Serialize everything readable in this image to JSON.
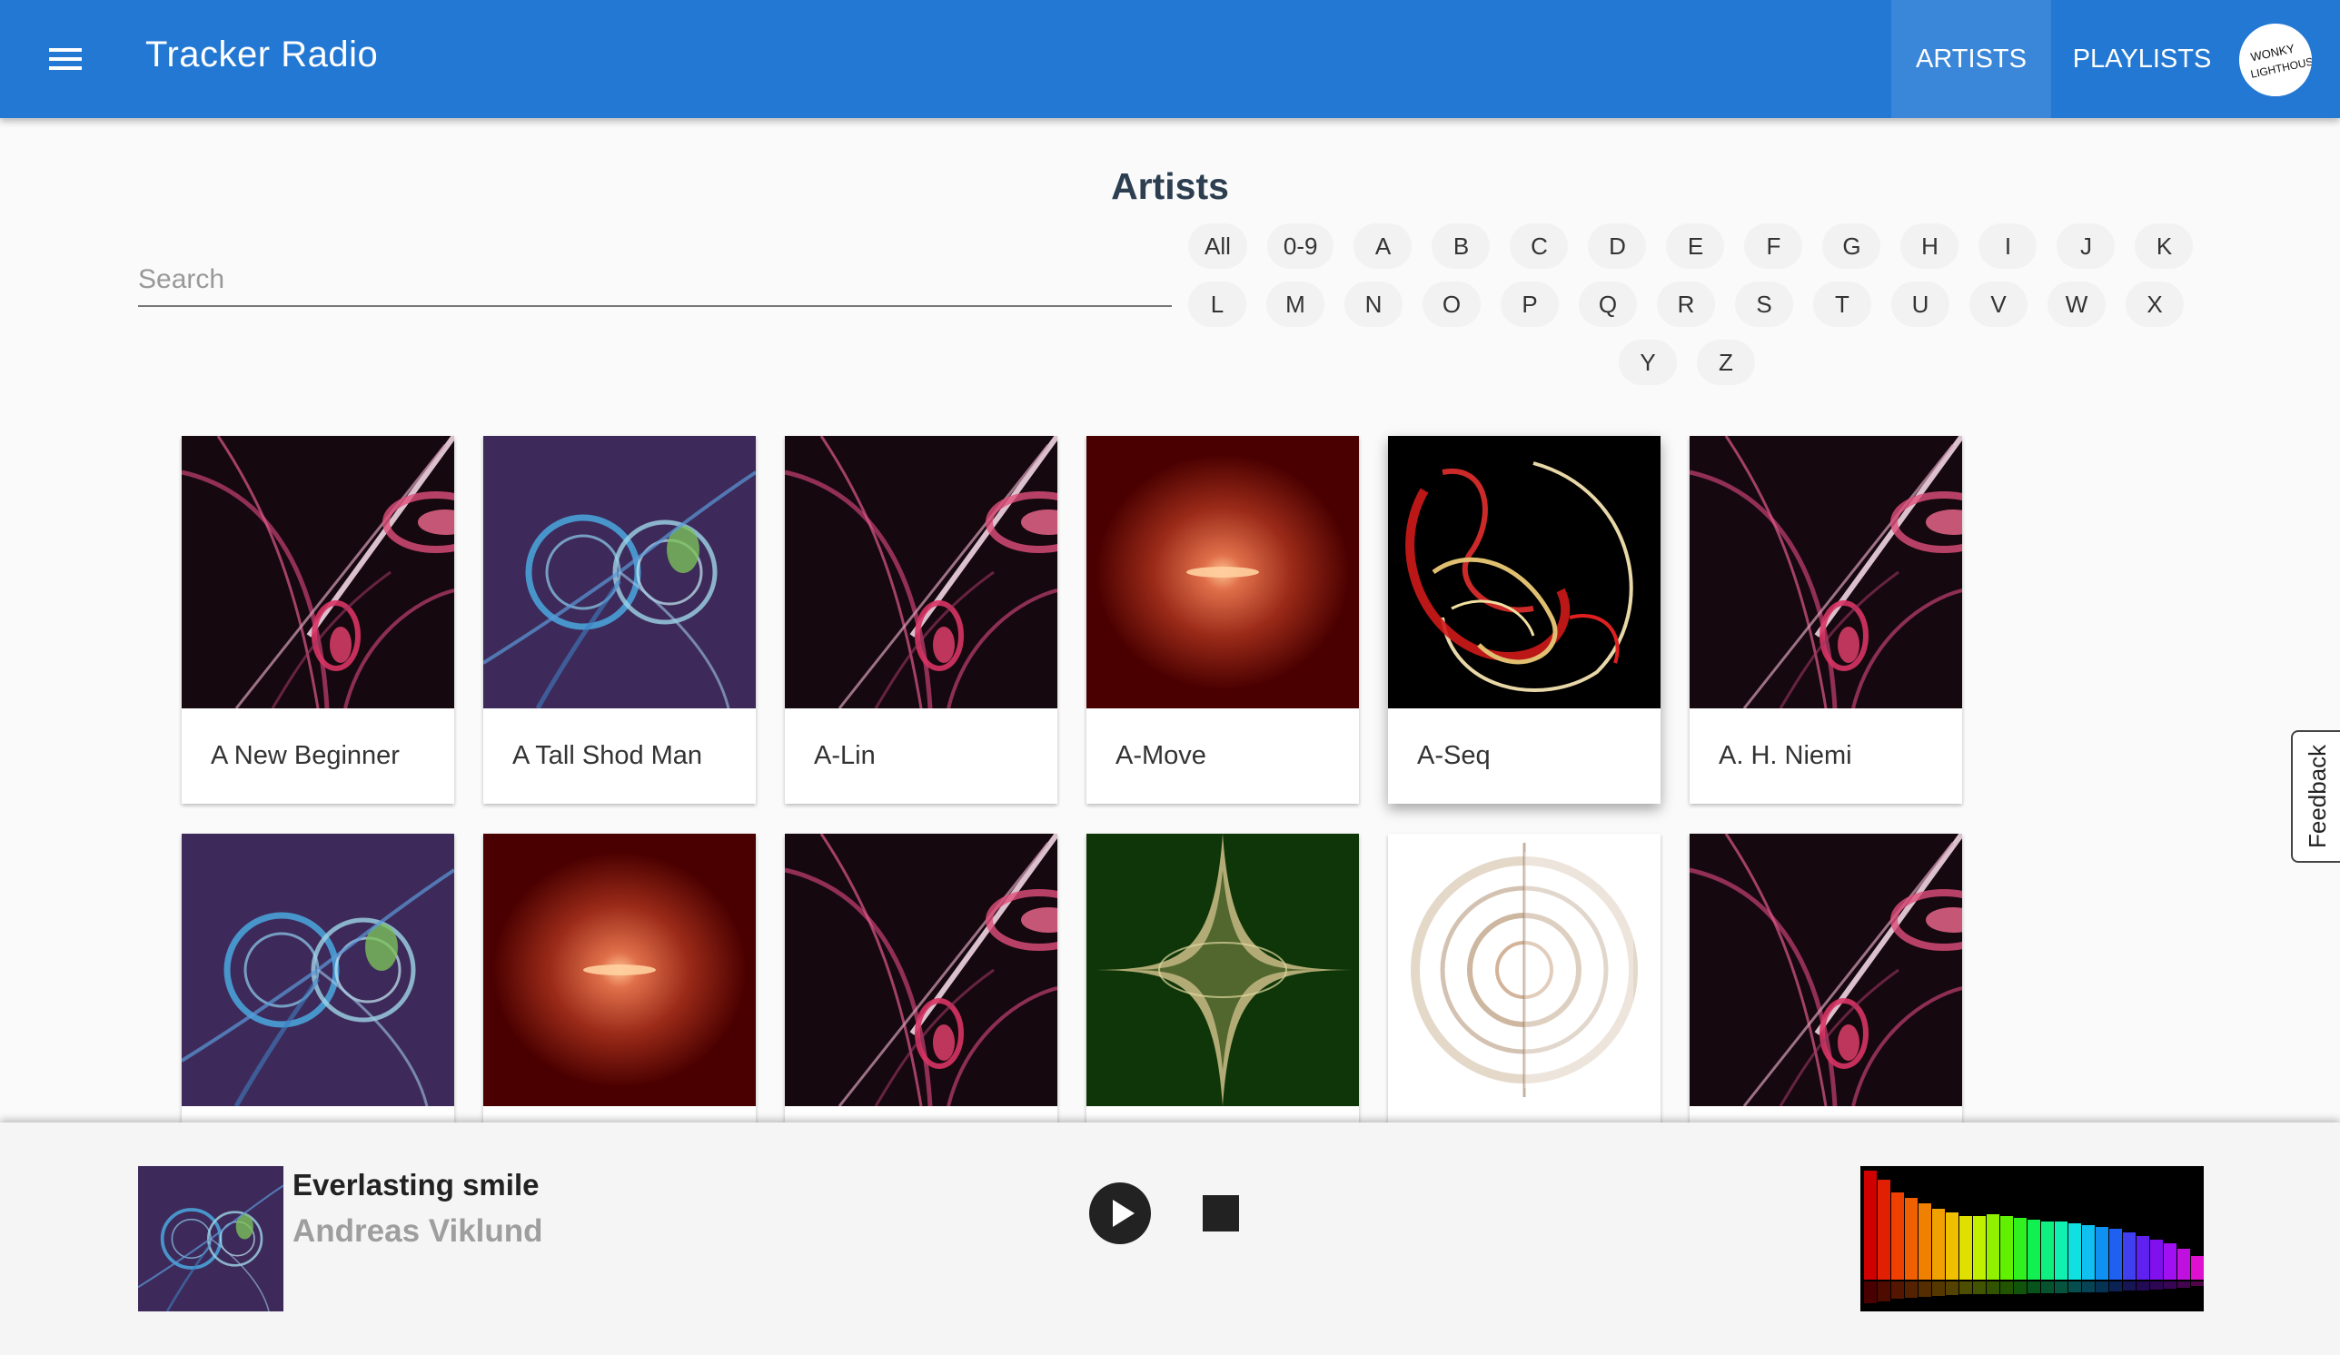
{
  "header": {
    "app_title": "Tracker Radio",
    "nav": [
      {
        "label": "ARTISTS",
        "active": true
      },
      {
        "label": "PLAYLISTS",
        "active": false
      }
    ],
    "avatar_text": "WONKY LIGHTHOUSE",
    "brand_color": "#2378d3"
  },
  "page": {
    "title": "Artists",
    "search_placeholder": "Search",
    "letter_filters": [
      "All",
      "0-9",
      "A",
      "B",
      "C",
      "D",
      "E",
      "F",
      "G",
      "H",
      "I",
      "J",
      "K",
      "L",
      "M",
      "N",
      "O",
      "P",
      "Q",
      "R",
      "S",
      "T",
      "U",
      "V",
      "W",
      "X",
      "Y",
      "Z"
    ]
  },
  "artists": [
    {
      "name": "A New Beginner",
      "art": "pink-swirl"
    },
    {
      "name": "A Tall Shod Man",
      "art": "blue-swirl"
    },
    {
      "name": "A-Lin",
      "art": "pink-swirl"
    },
    {
      "name": "A-Move",
      "art": "red-nebula"
    },
    {
      "name": "A-Seq",
      "art": "red-spiral"
    },
    {
      "name": "A. H. Niemi",
      "art": "pink-swirl"
    },
    {
      "name": "",
      "art": "blue-swirl"
    },
    {
      "name": "",
      "art": "red-nebula"
    },
    {
      "name": "",
      "art": "pink-swirl"
    },
    {
      "name": "",
      "art": "green-star"
    },
    {
      "name": "",
      "art": "white-spiral"
    },
    {
      "name": "",
      "art": "pink-swirl"
    }
  ],
  "player": {
    "track_title": "Everlasting smile",
    "track_artist": "Andreas Viklund",
    "play_icon": "play-icon",
    "stop_icon": "stop-icon"
  },
  "feedback": {
    "label": "Feedback"
  }
}
